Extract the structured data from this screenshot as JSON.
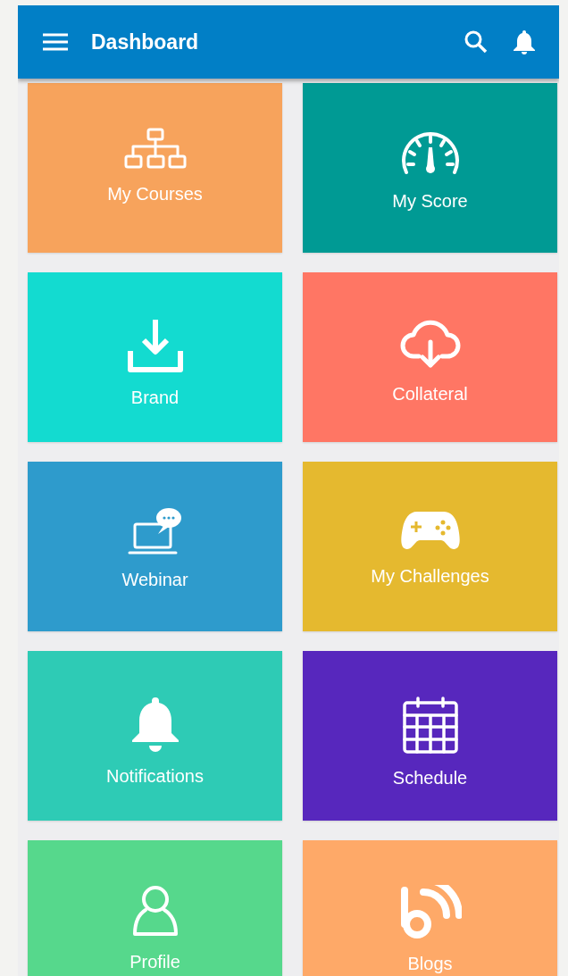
{
  "app_bar": {
    "title": "Dashboard"
  },
  "tiles": [
    {
      "label": "My Courses",
      "color": "#f7a35c"
    },
    {
      "label": "My Score",
      "color": "#009a94"
    },
    {
      "label": "Brand",
      "color": "#13dbd0"
    },
    {
      "label": "Collateral",
      "color": "#ff7664"
    },
    {
      "label": "Webinar",
      "color": "#2e9bcc"
    },
    {
      "label": "My Challenges",
      "color": "#e5b92f"
    },
    {
      "label": "Notifications",
      "color": "#2ecbb5"
    },
    {
      "label": "Schedule",
      "color": "#5727bd"
    },
    {
      "label": "Profile",
      "color": "#56d88c"
    },
    {
      "label": "Blogs",
      "color": "#fea968"
    }
  ]
}
